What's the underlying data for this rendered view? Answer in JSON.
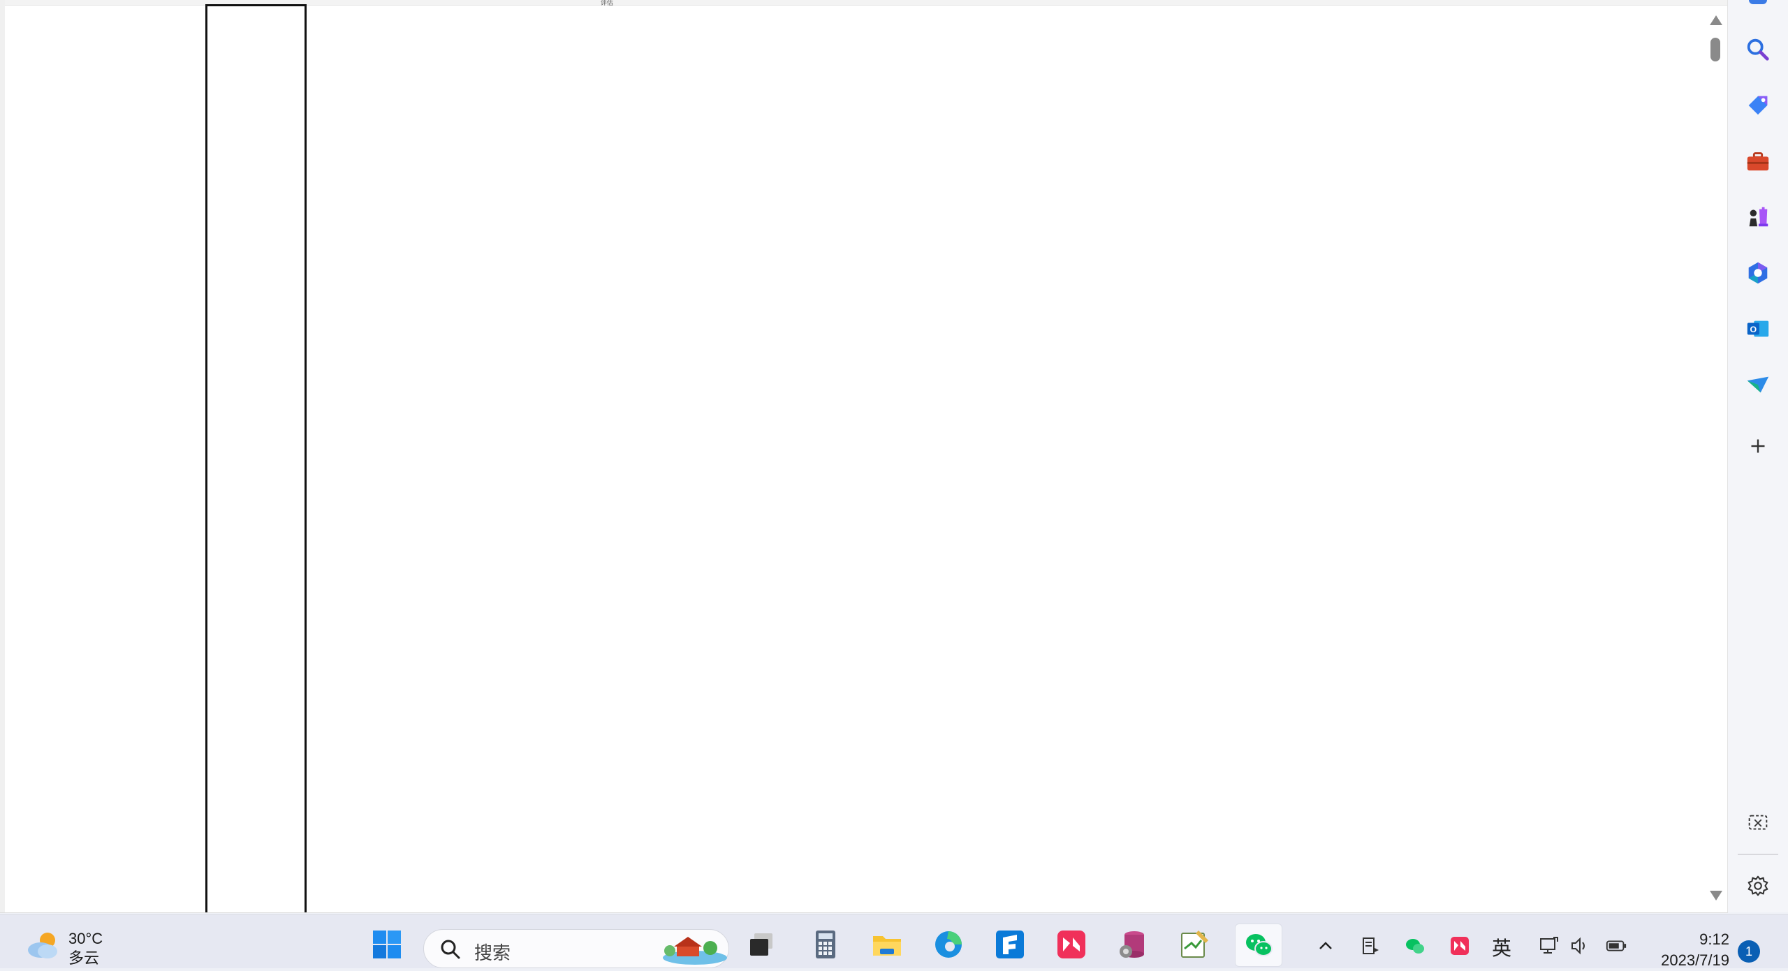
{
  "document": {
    "page_fragment_text": "评估"
  },
  "sidebar": {
    "items": [
      {
        "name": "search-icon"
      },
      {
        "name": "shopping-tag-icon"
      },
      {
        "name": "toolbox-icon"
      },
      {
        "name": "chess-games-icon"
      },
      {
        "name": "office-m365-icon"
      },
      {
        "name": "outlook-icon"
      },
      {
        "name": "telegram-send-icon"
      },
      {
        "name": "add-icon"
      }
    ],
    "bottom": [
      {
        "name": "screenshot-icon"
      },
      {
        "name": "settings-icon"
      }
    ]
  },
  "taskbar": {
    "weather": {
      "temperature": "30°C",
      "condition": "多云"
    },
    "search_placeholder": "搜索",
    "apps": [
      "start-icon",
      "task-view-icon",
      "calculator-icon",
      "file-explorer-icon",
      "edge-icon",
      "app-f-icon",
      "app-red-icon",
      "database-icon",
      "notepad-icon",
      "wechat-icon"
    ],
    "language": "英",
    "time": "9:12",
    "date": "2023/7/19",
    "notification_count": "1"
  },
  "colors": {
    "accent": "#0a5fb4",
    "wechat_green": "#07c160",
    "start_blue": "#1e8cf0"
  }
}
